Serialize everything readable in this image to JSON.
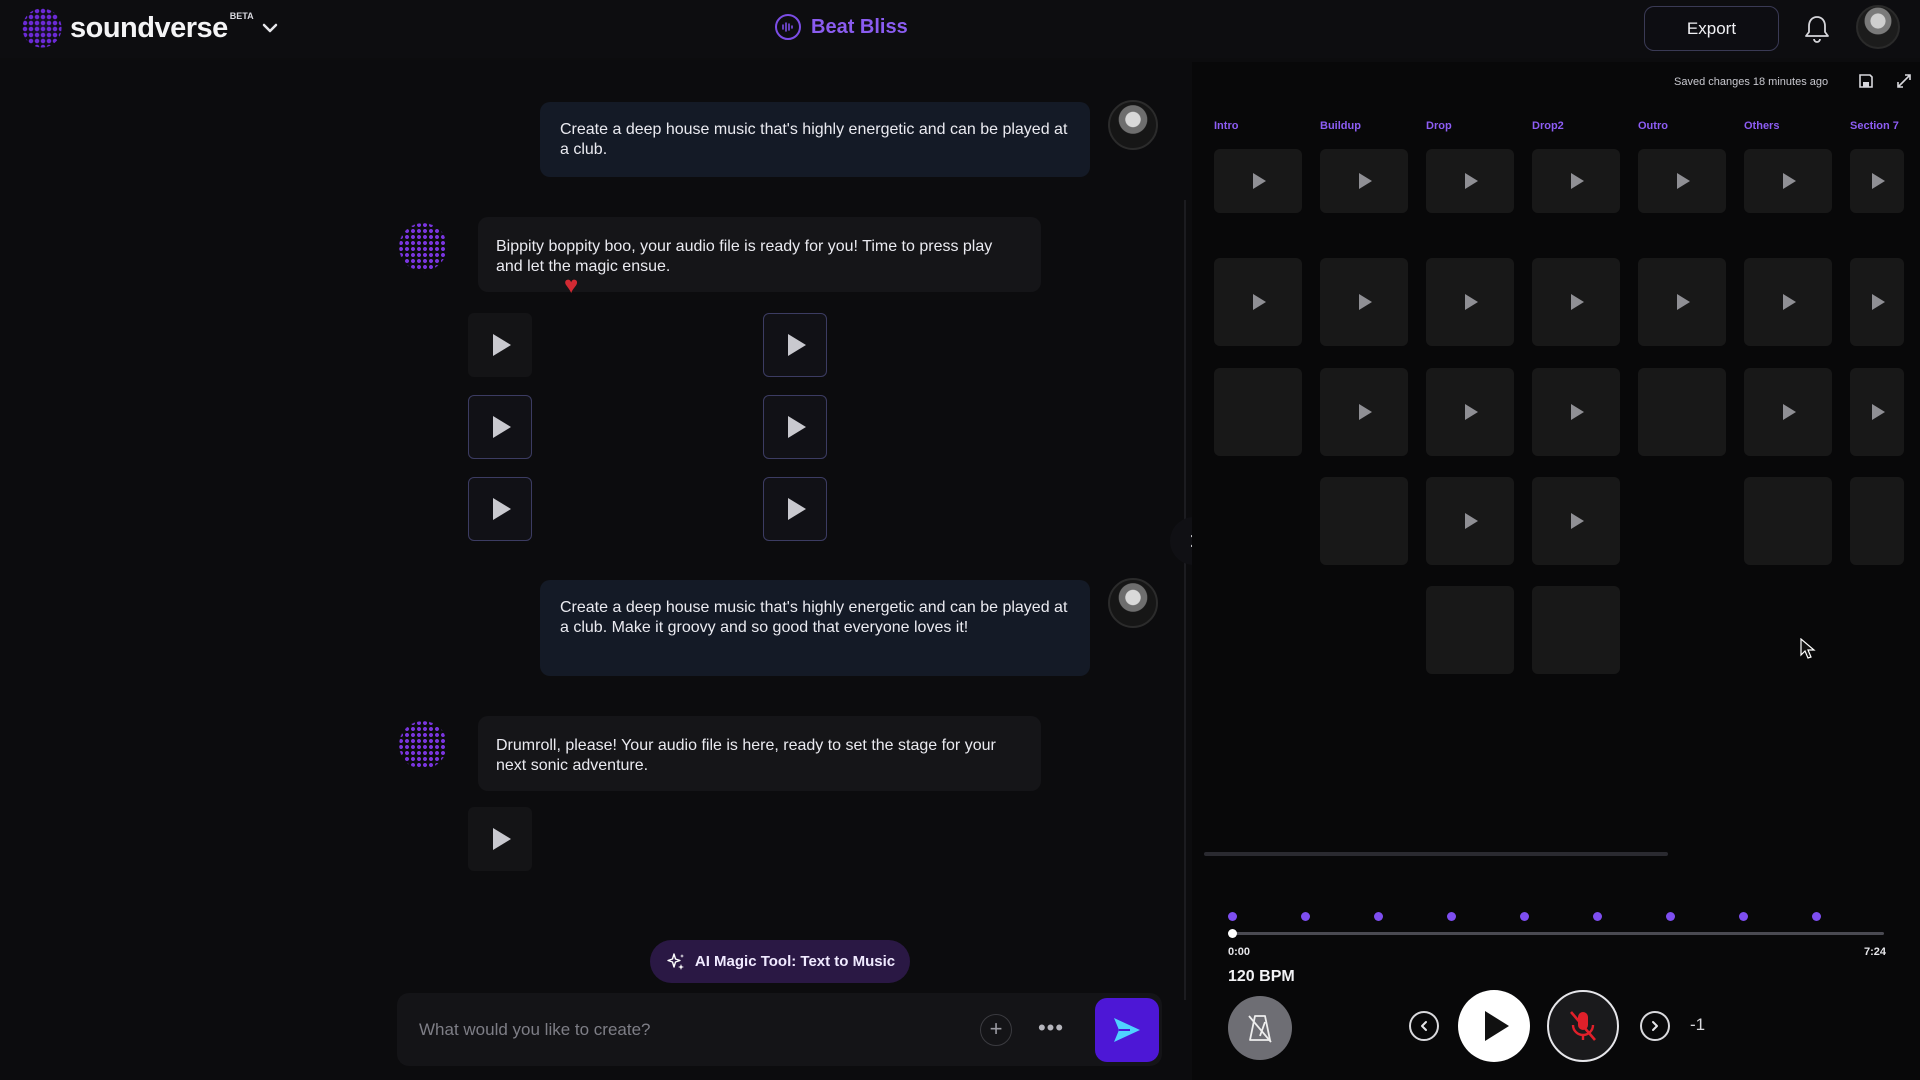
{
  "app": {
    "brand": "soundverse",
    "beta": "BETA",
    "project_title": "Beat Bliss",
    "export_label": "Export",
    "accent": "#7b4de6",
    "send_color": "#4d17d6"
  },
  "chat": {
    "messages": [
      {
        "role": "user",
        "text": "Create a deep house music that's highly energetic and can be played at a club."
      },
      {
        "role": "assistant",
        "text": "Bippity boppity boo, your audio file is ready for you! Time to press play and let the magic ensue."
      },
      {
        "role": "user",
        "text": "Create a deep house music that's highly energetic and can be played at a club. Make it groovy and so good that everyone loves it!"
      },
      {
        "role": "assistant",
        "text": "Drumroll, please! Your audio file is here, ready to set the stage for your next sonic adventure."
      }
    ],
    "liked_clip": 1,
    "magic_tool_label": "AI Magic Tool: Text to Music",
    "input_placeholder": "What would you like to create?",
    "input_value": ""
  },
  "panel": {
    "saved_status": "Saved changes 18 minutes ago",
    "sections": [
      "Intro",
      "Buildup",
      "Drop",
      "Drop2",
      "Outro",
      "Others",
      "Section 7"
    ],
    "playback": {
      "time_start": "0:00",
      "time_end": "7:24",
      "progress": 0,
      "bpm": "120 BPM",
      "offset": "-1"
    }
  }
}
